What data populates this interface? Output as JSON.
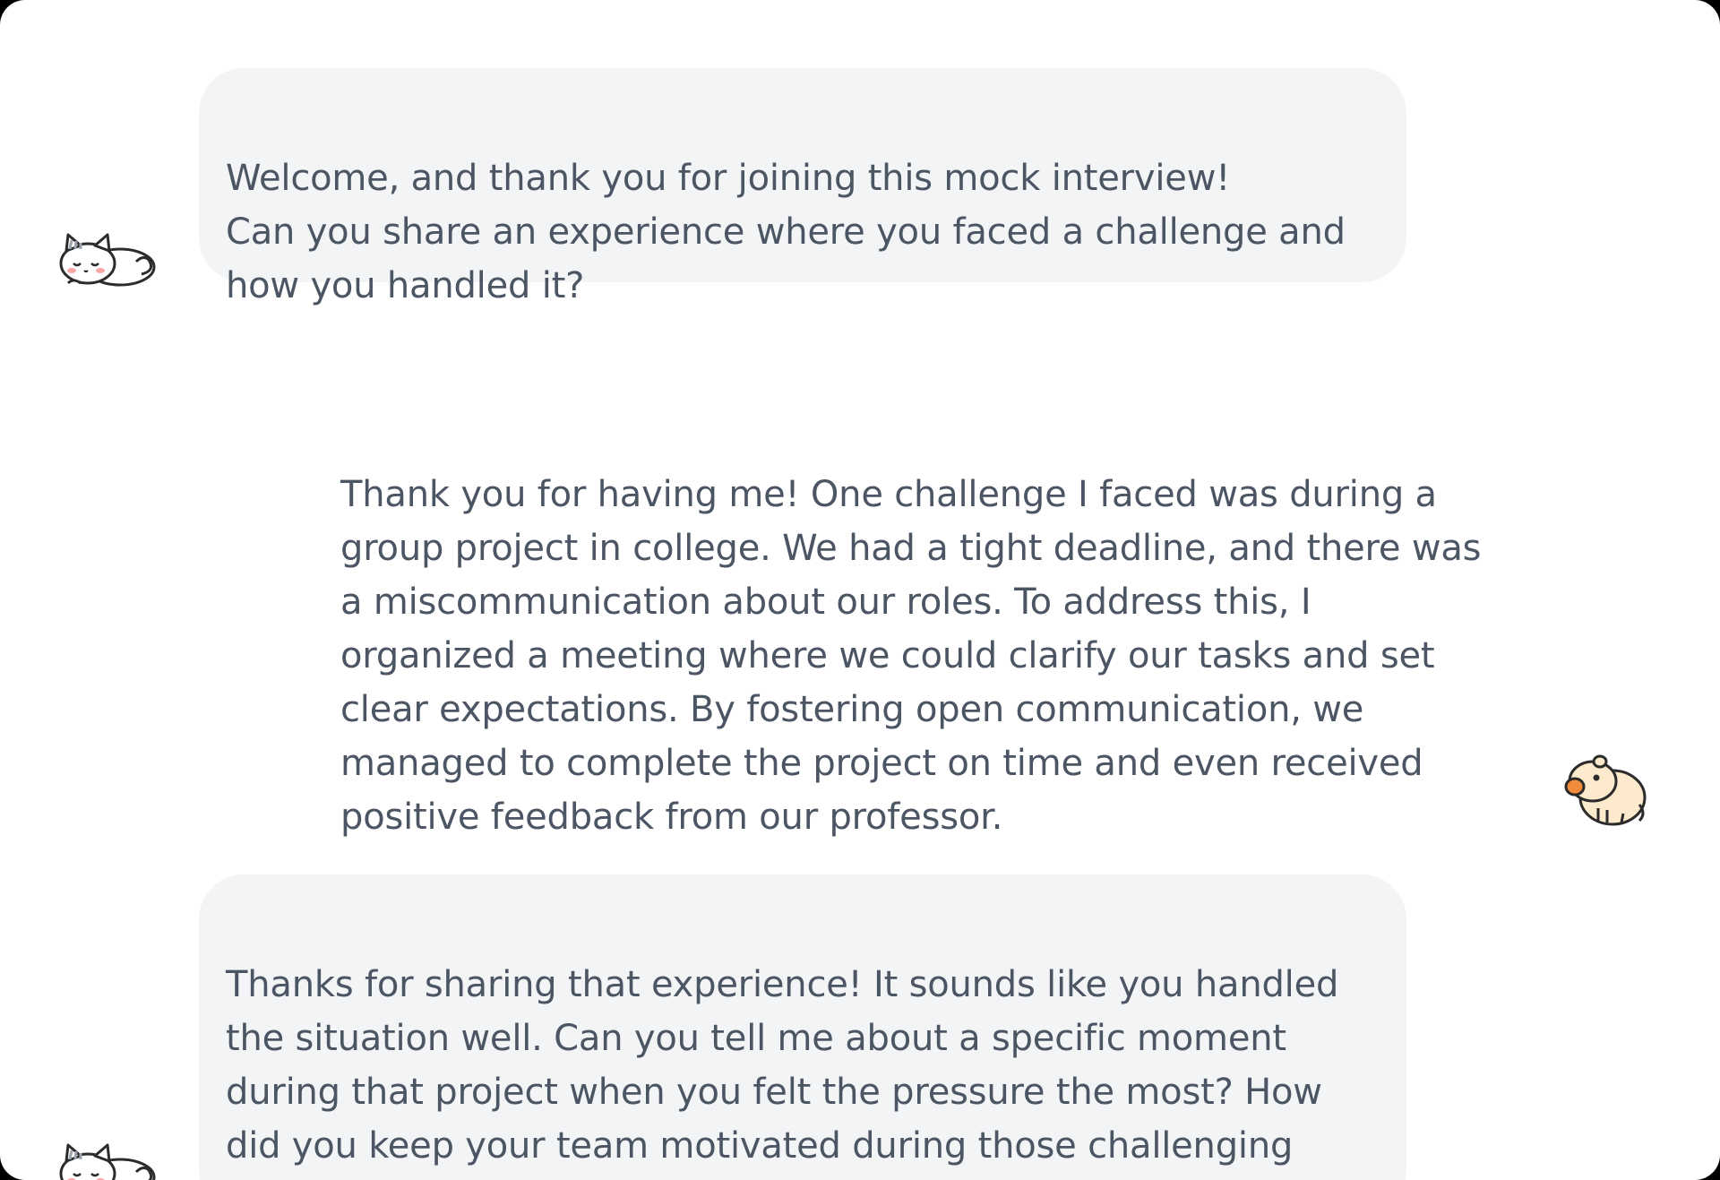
{
  "conversation": {
    "messages": [
      {
        "role": "interviewer",
        "avatar_icon": "sleeping-cat-icon",
        "text": "Welcome, and thank you for joining this mock interview!\nCan you share an experience where you faced a challenge and\nhow you handled it?"
      },
      {
        "role": "candidate",
        "avatar_icon": "capybara-icon",
        "text": "Thank you for having me! One challenge I faced was during a\ngroup project in college. We had a tight deadline, and there was\na miscommunication about our roles. To address this, I\norganized a meeting where we could clarify our tasks and set\nclear expectations. By fostering open communication, we\nmanaged to complete the project on time and even received\npositive feedback from our professor."
      },
      {
        "role": "interviewer",
        "avatar_icon": "sleeping-cat-icon",
        "text": "Thanks for sharing that experience! It sounds like you handled\nthe situation well. Can you tell me about a specific moment\nduring that project when you felt the pressure the most? How\ndid you keep your team motivated during those challenging\ntimes?"
      }
    ]
  },
  "colors": {
    "window_background": "#ffffff",
    "bubble_background": "#f3f4f6",
    "text": "#4b5563",
    "frame": "#000000"
  }
}
